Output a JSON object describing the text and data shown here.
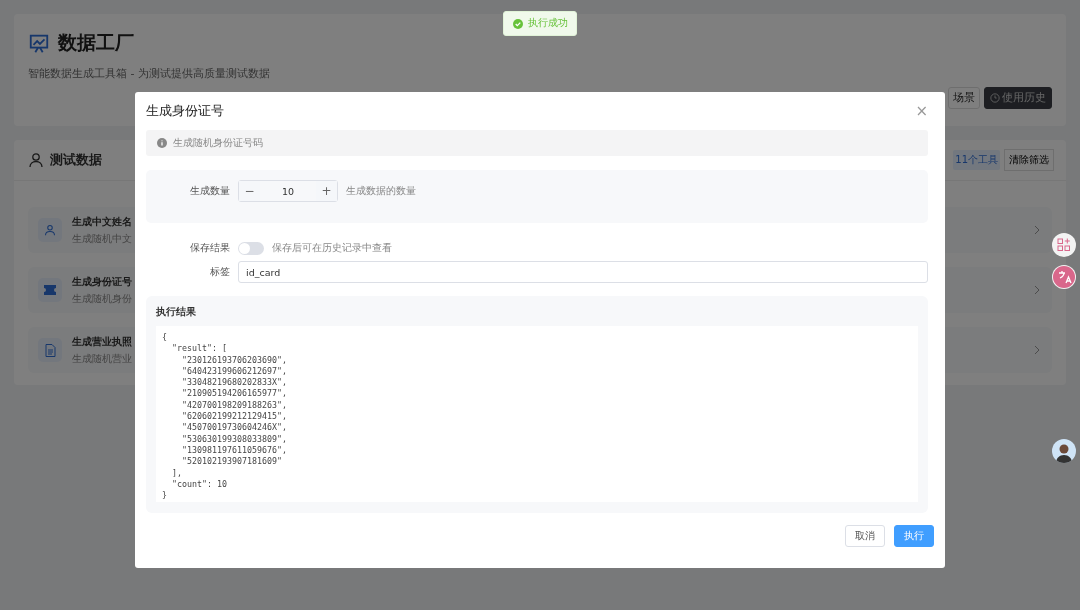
{
  "toast": {
    "kind": "success",
    "text": "执行成功"
  },
  "header": {
    "title": "数据工厂",
    "subtitle": "智能数据生成工具箱 - 为测试提供高质量测试数据",
    "buttons": [
      {
        "label": "场景",
        "kind": "plain"
      },
      {
        "label": "使用历史",
        "kind": "dark"
      }
    ]
  },
  "section": {
    "title": "测试数据",
    "count": "11个工具",
    "clear_button": "清除筛选",
    "tools": [
      {
        "kind": "person",
        "name": "生成中文姓名",
        "desc": "生成随机中文"
      },
      {
        "kind": "card",
        "name": "生成身份证号",
        "desc": "生成随机身份"
      },
      {
        "kind": "doc",
        "name": "生成营业执照",
        "desc": "生成随机营业"
      }
    ]
  },
  "dialog": {
    "title": "生成身份证号",
    "close": "×",
    "info": "生成随机身份证号码",
    "count_label": "生成数量",
    "count_minus": "−",
    "count_value": "10",
    "count_plus": "+",
    "count_hint": "生成数据的数量",
    "save_label": "保存结果",
    "save_toggle": {
      "on": false
    },
    "save_hint": "保存后可在历史记录中查看",
    "tag_label": "标签",
    "tag_value": "id_card",
    "result_title": "执行结果",
    "result_text": "{\n  \"result\": [\n    \"230126193706203690\",\n    \"640423199606212697\",\n    \"33048219680202833X\",\n    \"210905194206165977\",\n    \"420700198209188263\",\n    \"620602199212129415\",\n    \"45070019730604246X\",\n    \"530630199308033809\",\n    \"130981197611059676\",\n    \"520102193907181609\"\n  ],\n  \"count\": 10\n}",
    "cancel": "取消",
    "run": "执行"
  }
}
